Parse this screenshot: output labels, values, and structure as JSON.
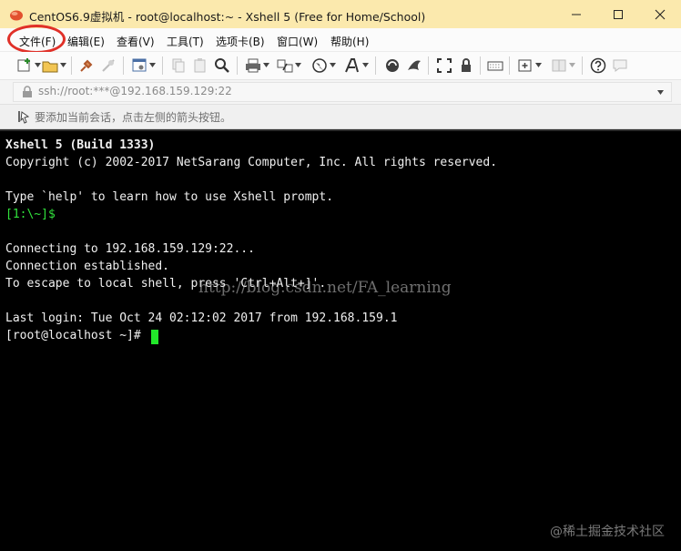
{
  "window": {
    "title": "CentOS6.9虚拟机 - root@localhost:~ - Xshell 5 (Free for Home/School)"
  },
  "menu": {
    "items": [
      "文件(F)",
      "编辑(E)",
      "查看(V)",
      "工具(T)",
      "选项卡(B)",
      "窗口(W)",
      "帮助(H)"
    ]
  },
  "address": {
    "value": "ssh://root:***@192.168.159.129:22"
  },
  "hint": {
    "text": "要添加当前会话，点击左侧的箭头按钮。"
  },
  "terminal": {
    "lines": [
      "Xshell 5 (Build 1333)",
      "Copyright (c) 2002-2017 NetSarang Computer, Inc. All rights reserved.",
      "",
      "Type `help' to learn how to use Xshell prompt.",
      "[1:\\~]$",
      "",
      "Connecting to 192.168.159.129:22...",
      "Connection established.",
      "To escape to local shell, press 'Ctrl+Alt+]'.",
      "",
      "Last login: Tue Oct 24 02:12:02 2017 from 192.168.159.1",
      "[root@localhost ~]# "
    ],
    "watermark": "http://blog.csdn.net/FA_learning",
    "juejin_watermark": "@稀土掘金技术社区"
  },
  "colors": {
    "titlebar": "#fbe9ad",
    "terminal_bg": "#000000",
    "prompt_green": "#31e23c",
    "highlight_red": "#e03028"
  },
  "icons": [
    "new-session-icon",
    "open-folder-icon",
    "connect-icon",
    "disconnect-icon",
    "properties-icon",
    "copy-icon",
    "paste-icon",
    "find-icon",
    "print-icon",
    "transfer-icon",
    "globe-icon",
    "font-icon",
    "xftp-icon",
    "xagent-icon",
    "fullscreen-icon",
    "lock-icon",
    "keyboard-icon",
    "new-tab-icon",
    "layout-icon",
    "help-icon",
    "chat-icon"
  ]
}
